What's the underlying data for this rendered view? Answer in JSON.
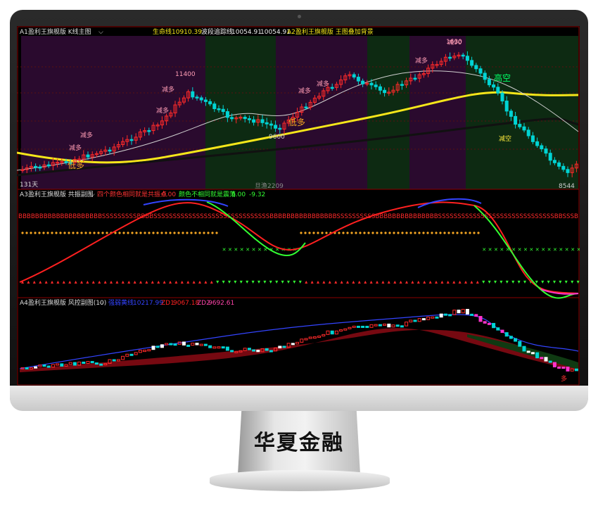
{
  "brand_text": "华夏金融",
  "panel1": {
    "title": "A1盈利王旗舰版 K线主图",
    "items": [
      {
        "label": "生命线",
        "value": "10910.39"
      },
      {
        "label": "波段追踪线",
        "value": "10054.91"
      },
      {
        "label": "",
        "value": "10054.91"
      }
    ],
    "extra": "A2盈利王旗舰版 王图叠加背景",
    "price_11400": "11400",
    "price_high": "1630",
    "price_low": "8544",
    "price_mid": "9600",
    "days": "131天",
    "bottom_text": "旦渔2209",
    "labels": {
      "reduce": "减多",
      "low_more": "低多",
      "high_short": "高空",
      "reduce_short": "减空",
      "reduce2": "减90"
    }
  },
  "panel2": {
    "title": "A3盈利王旗舰版 共振副图",
    "text1": "四个颜色相同就是共振点",
    "val1": "0.00",
    "text2": "颜色不相同就是震荡",
    "val2": "0.00",
    "val3": "-9.32",
    "b_row": "BBBBBBBBBBBBBBBBBBBBSSSSSSSSSBBBBSSSSSSSSSSSSSSSSSSSSSSSSSSSSSSBBBBBBBBBBBBBBBBSSSSSSSSSSBBBBBBBBBBBBBBBSSSSSSSSSSSSSSSSSSSSSSSSSSSSSSBBSSSB"
  },
  "panel3": {
    "title": "A4盈利王旗舰版 风控副图(10)",
    "items": [
      {
        "label": "强弱黄线",
        "value": "10217.99",
        "color": "#3344ff"
      },
      {
        "label": "ZD1",
        "value": "9067.18",
        "color": "#ff2222"
      },
      {
        "label": "ZD2",
        "value": "9692.61",
        "color": "#ff44aa"
      }
    ],
    "more": "多"
  },
  "colors": {
    "purple_bg": "#2a0a2e",
    "green_bg": "#0d2a12",
    "up": "#ff2a2a",
    "down": "#00d4d4",
    "yellow": "#f5e61a"
  }
}
